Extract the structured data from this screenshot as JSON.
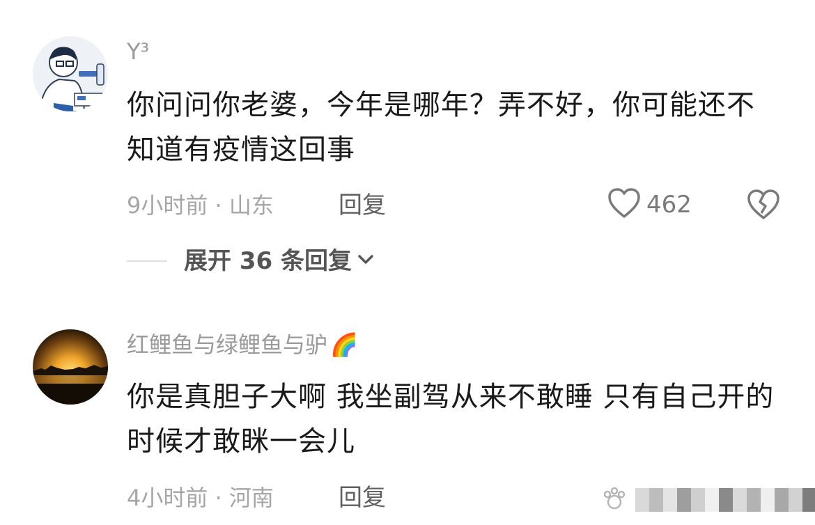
{
  "comments": [
    {
      "username": "Y³",
      "text": "你问问你老婆，今年是哪年？弄不好，你可能还不知道有疫情这回事",
      "meta": "9小时前 · 山东",
      "reply_label": "回复",
      "likes": "462",
      "expand_label": "展开 36 条回复"
    },
    {
      "username": "红鲤鱼与绿鲤鱼与驴",
      "username_emoji": "🌈",
      "text": "你是真胆子大啊  我坐副驾从来不敢睡  只有自己开的时候才敢眯一会儿",
      "meta": "4小时前 · 河南",
      "reply_label": "回复"
    }
  ],
  "icons": {
    "like": "heart-outline-icon",
    "dislike": "broken-heart-icon",
    "expand": "chevron-down-icon"
  },
  "colors": {
    "username": "#9a9a9a",
    "meta": "#a6a6a6",
    "text": "#1a1a1a"
  }
}
